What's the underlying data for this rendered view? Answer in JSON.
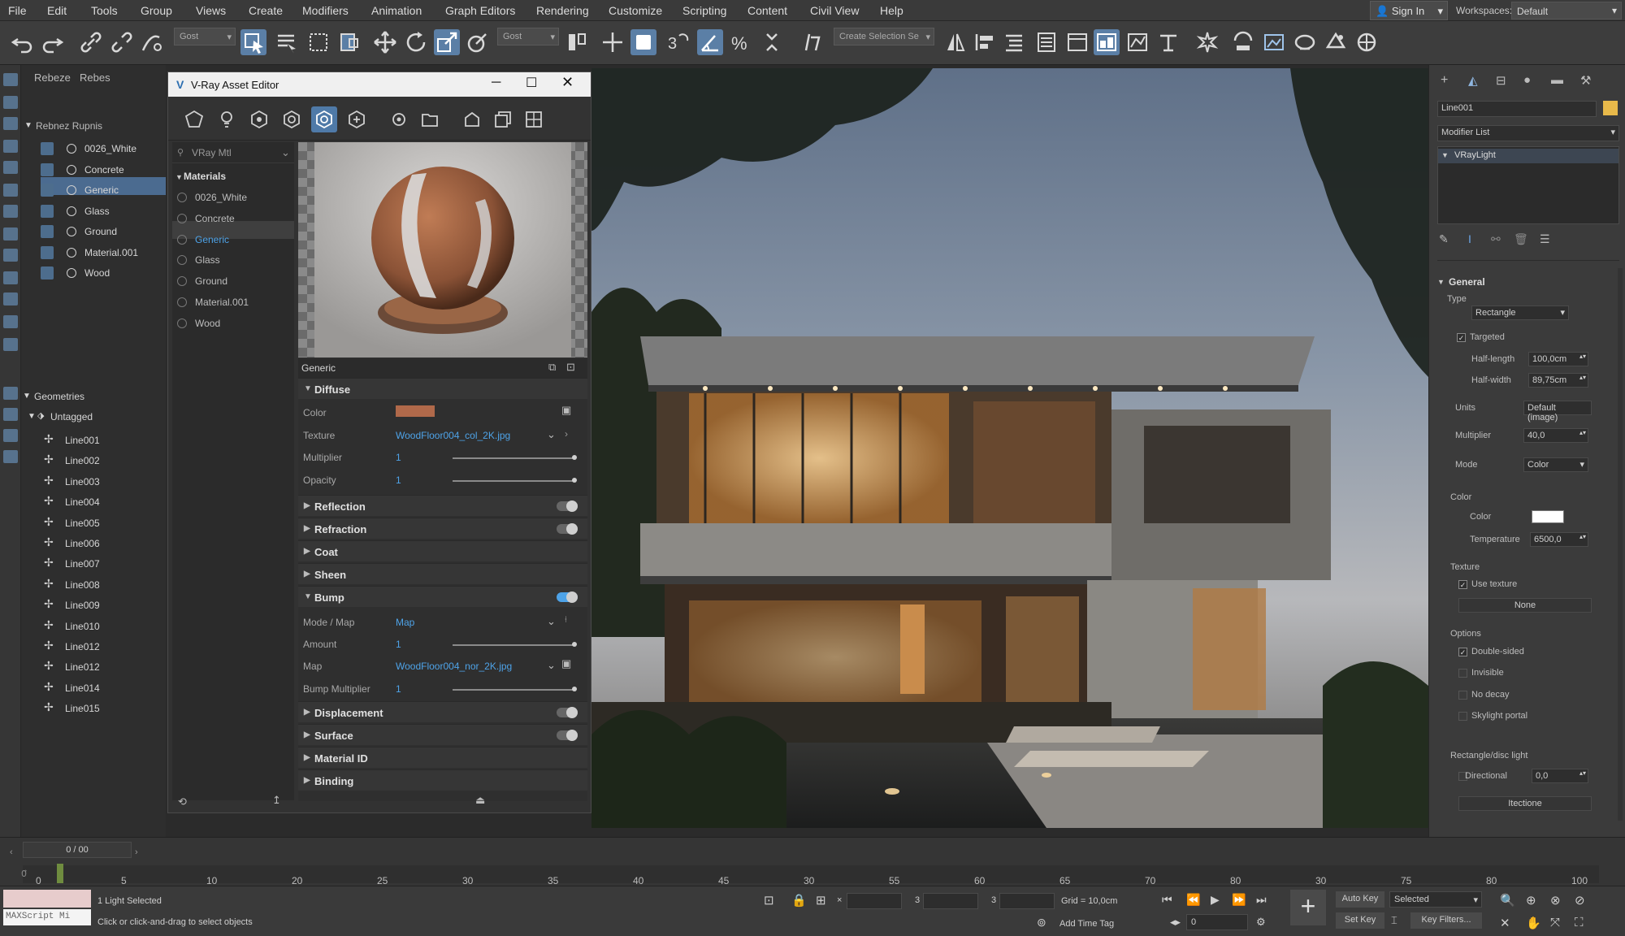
{
  "menu": {
    "items": [
      "File",
      "Edit",
      "Tools",
      "Group",
      "Views",
      "Create",
      "Modifiers",
      "Animation",
      "Graph Editors",
      "Rendering",
      "Customize",
      "Scripting",
      "Content",
      "Civil View",
      "Help"
    ],
    "sign_in": "Sign In",
    "workspaces_label": "Workspaces:",
    "workspace_value": "Default"
  },
  "toolbar": {
    "dropdown1": "Gost",
    "dropdown2": "Gost",
    "selection_set": "Create Selection Se"
  },
  "explorer": {
    "tabs": [
      "Rebeze",
      "Rebes"
    ],
    "root_label": "Rebnez Rupnis",
    "materials": [
      "0026_White",
      "Concrete",
      "Generic",
      "Glass",
      "Ground",
      "Material.001",
      "Wood"
    ],
    "geometries_label": "Geometries",
    "untagged_label": "Untagged",
    "lines": [
      "Line001",
      "Line002",
      "Line003",
      "Line004",
      "Line005",
      "Line006",
      "Line007",
      "Line008",
      "Line009",
      "Line010",
      "Line012",
      "Line012",
      "Line014",
      "Line015"
    ]
  },
  "asset_editor": {
    "title": "V-Ray Asset Editor",
    "filter": "VRay Mtl",
    "materials_header": "Materials",
    "materials": [
      "0026_White",
      "Concrete",
      "Generic",
      "Glass",
      "Ground",
      "Material.001",
      "Wood"
    ],
    "selected_material": "Generic",
    "props_title": "Generic",
    "sections": {
      "diffuse": "Diffuse",
      "reflection": "Reflection",
      "refraction": "Refraction",
      "coat": "Coat",
      "sheen": "Sheen",
      "bump": "Bump",
      "displacement": "Displacement",
      "surface": "Surface",
      "material_id": "Material ID",
      "binding": "Binding"
    },
    "diffuse": {
      "color_label": "Color",
      "color_value": "#b0694a",
      "texture_label": "Texture",
      "texture_value": "WoodFloor004_col_2K.jpg",
      "multiplier_label": "Multiplier",
      "multiplier_value": "1",
      "opacity_label": "Opacity",
      "opacity_value": "1"
    },
    "bump": {
      "mode_label": "Mode / Map",
      "mode_value": "Map",
      "amount_label": "Amount",
      "amount_value": "1",
      "map_label": "Map",
      "map_value": "WoodFloor004_nor_2K.jpg",
      "bump_mult_label": "Bump Multiplier",
      "bump_mult_value": "1"
    },
    "toggles": {
      "reflection": false,
      "refraction": false,
      "bump": true,
      "displacement": false,
      "surface": false
    }
  },
  "command_panel": {
    "object_name": "Line001",
    "modifier_list": "Modifier List",
    "stack_item": "VRayLight",
    "general": "General",
    "type_label": "Type",
    "type_value": "Rectangle",
    "targeted": "Targeted",
    "half_length_label": "Half-length",
    "half_length_value": "100,0cm",
    "half_width_label": "Half-width",
    "half_width_value": "89,75cm",
    "units_label": "Units",
    "units_value": "Default (image)",
    "multiplier_label": "Multiplier",
    "multiplier_value": "40,0",
    "mode_label": "Mode",
    "mode_value": "Color",
    "color_section": "Color",
    "color_label": "Color",
    "temperature_label": "Temperature",
    "temperature_value": "6500,0",
    "texture_section": "Texture",
    "use_texture": "Use texture",
    "none_button": "None",
    "options_section": "Options",
    "double_sided": "Double-sided",
    "invisible": "Invisible",
    "no_decay": "No decay",
    "skylight_portal": "Skylight portal",
    "rect_disc_label": "Rectangle/disc light",
    "directional_label": "Directional",
    "directional_value": "0,0",
    "bottom_button": "Itectione"
  },
  "timeline": {
    "frame_counter": "0 / 00",
    "ticks": [
      "0",
      "5",
      "10",
      "20",
      "25",
      "30",
      "35",
      "40",
      "45",
      "30",
      "55",
      "60",
      "65",
      "70",
      "80",
      "30",
      "75",
      "80",
      "100"
    ]
  },
  "status": {
    "maxscript": "MAXScript Mi",
    "selected": "1 Light Selected",
    "hint": "Click or click-and-drag to select objects",
    "grid": "Grid = 10,0cm",
    "add_time_tag": "Add Time Tag",
    "auto_key": "Auto Key",
    "selected_dropdown": "Selected",
    "set_key": "Set Key",
    "key_filters": "Key Filters...",
    "frame_value": "0",
    "x_value": "3",
    "y_value": "3"
  }
}
